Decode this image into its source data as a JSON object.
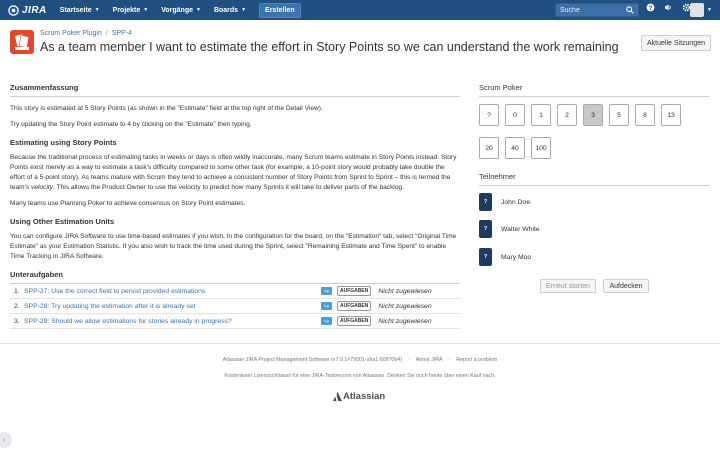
{
  "nav": {
    "logo_text": "JIRA",
    "items": [
      {
        "label": "Startseite"
      },
      {
        "label": "Projekte"
      },
      {
        "label": "Vorgänge"
      },
      {
        "label": "Boards"
      }
    ],
    "create_label": "Erstellen",
    "search_placeholder": "Suche",
    "icons": [
      "help-icon",
      "notification-icon",
      "settings-icon"
    ]
  },
  "header": {
    "breadcrumb_project": "Scrum Poker Plugin",
    "breadcrumb_sep": "/",
    "breadcrumb_issue": "SPP-4",
    "title": "As a team member I want to estimate the effort in Story Points so we can understand the work remaining",
    "sessions_button": "Aktuelle Sitzungen"
  },
  "summary": {
    "heading": "Zusammenfassung",
    "p1": "This story is estimated at 5 Story Points (as shown in the \"Estimate\" field at the top right of the Detail View).",
    "p2": "Try updating the Story Point estimate to 4 by clicking on the \"Estimate\" then typing.",
    "h_est": "Estimating using Story Points",
    "p3a": "Because the traditional process of estimating tasks in weeks or days is often wildly inaccurate, many Scrum teams estimate in Story Points instead. Story Points exist merely as a way to estimate a task's difficulty compared to some other task (for example, a 10-point story would probably take double the effort of a 5-point story). As teams mature with Scrum they tend to achieve a consistent number of Story Points from Sprint to Sprint – this is termed the team's ",
    "p3_em": "velocity",
    "p3b": ". This allows the Product Owner to use the velocity to predict how many Sprints it will take to deliver parts of the backlog.",
    "p4": "Many teams use Planning Poker to achieve consensus on Story Point estimates.",
    "h_other": "Using Other Estimation Units",
    "p5": "You can configure JIRA Software to use time-based estimates if you wish. In the configuration for the board, on the \"Estimation\" tab, select \"Original Time Estimate\" as your Estimation Statistic. If you also wish to track the time used during the Sprint, select \"Remaining Estimate and Time Spent\" to enable Time Tracking in JIRA Software."
  },
  "subtasks": {
    "heading": "Unteraufgaben",
    "rows": [
      {
        "num": "1.",
        "link": "SPP-27: Use the correct field to persist provided estimations",
        "status": "AUFGABEN",
        "assignee": "Nicht zugewiesen"
      },
      {
        "num": "2.",
        "link": "SPP-28: Try updating the estimation after it is already set",
        "status": "AUFGABEN",
        "assignee": "Nicht zugewiesen"
      },
      {
        "num": "3.",
        "link": "SPP-29: Should we allow estimations for stories already in progress?",
        "status": "AUFGABEN",
        "assignee": "Nicht zugewiesen"
      }
    ]
  },
  "poker": {
    "heading": "Scrum Poker",
    "cards": [
      "?",
      "0",
      "1",
      "2",
      "3",
      "5",
      "8",
      "13",
      "20",
      "40",
      "100"
    ],
    "selected_card": "3",
    "participants_heading": "Teilnehmer",
    "participants": [
      {
        "card": "?",
        "name": "John Doe"
      },
      {
        "card": "?",
        "name": "Walter White"
      },
      {
        "card": "?",
        "name": "Mary Moo"
      }
    ],
    "restart_label": "Erneut starten",
    "reveal_label": "Aufdecken"
  },
  "footer": {
    "line1_a": "Atlassian JIRA Project Management Software (v7.9.1#79001-sha1:60970b4)",
    "line1_b": "About JIRA",
    "line1_c": "Report a problem",
    "line1_sep": "·",
    "line2": "Kostenloser Lizenzschlüssel für eine JIRA-Testversion von Atlassian. Denken Sie noch heute über einen Kauf nach.",
    "logo_text": "Atlassian"
  }
}
